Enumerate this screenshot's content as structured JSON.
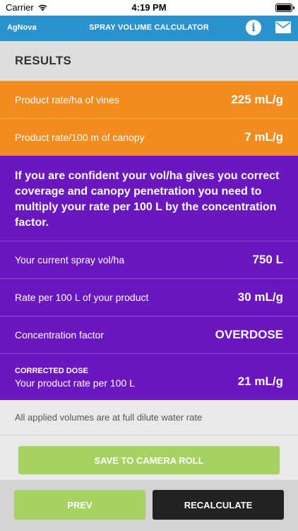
{
  "status_bar": {
    "carrier": "Carrier",
    "time": "4:19 PM"
  },
  "nav": {
    "brand": "AgNova",
    "title": "SPRAY VOLUME CALCULATOR",
    "info_icon": "info-icon",
    "mail_icon": "mail-icon"
  },
  "results": {
    "heading": "RESULTS"
  },
  "orange_rows": [
    {
      "label": "Product rate/ha of vines",
      "value": "225 mL/g"
    },
    {
      "label": "Product rate/100 m of canopy",
      "value": "7 mL/g"
    }
  ],
  "info_text": "If you are confident your vol/ha gives you correct coverage and canopy penetration you need to multiply your rate per 100 L by the concentration factor.",
  "purple_rows": [
    {
      "label": "Your current spray vol/ha",
      "value": "750 L"
    },
    {
      "label": "Rate per 100 L of your product",
      "value": "30 mL/g"
    },
    {
      "label": "Concentration factor",
      "value": "OVERDOSE"
    }
  ],
  "corrected": {
    "title": "CORRECTED DOSE",
    "label": "Your product rate per 100 L",
    "value": "21 mL/g"
  },
  "footnote": "All applied volumes are at full dilute water rate",
  "buttons": {
    "save": "SAVE TO CAMERA ROLL",
    "prev": "PREV",
    "recalculate": "RECALCULATE"
  },
  "colors": {
    "nav": "#2a93cd",
    "orange": "#f28c1e",
    "purple": "#6b17c0",
    "green": "#a6d264",
    "dark": "#222222"
  }
}
